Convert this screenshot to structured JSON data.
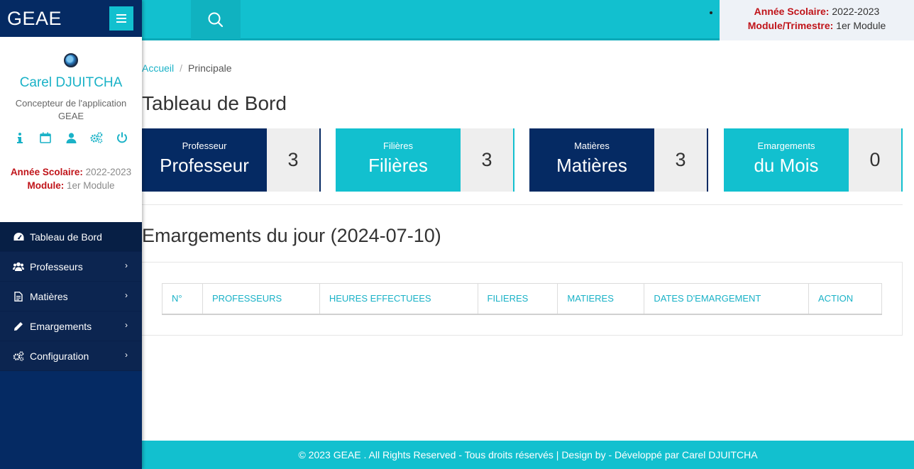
{
  "brand": {
    "name": "GEAE"
  },
  "profile": {
    "name": "Carel DJUITCHA",
    "role": "Concepteur de l'application GEAE",
    "year_label": "Année Scolaire:",
    "year_value": "2022-2023",
    "module_label": "Module:",
    "module_value": "1er Module"
  },
  "nav": [
    {
      "label": "Tableau de Bord",
      "icon": "dashboard-icon",
      "active": true
    },
    {
      "label": "Professeurs",
      "icon": "users-icon"
    },
    {
      "label": "Matières",
      "icon": "file-icon"
    },
    {
      "label": "Emargements",
      "icon": "pencil-icon"
    },
    {
      "label": "Configuration",
      "icon": "cogs-icon"
    }
  ],
  "topbar": {
    "year_label": "Année Scolaire:",
    "year_value": "2022-2023",
    "module_label": "Module/Trimestre:",
    "module_value": "1er Module"
  },
  "breadcrumb": {
    "home": "Accueil",
    "current": "Principale"
  },
  "page_title": "Tableau de Bord",
  "cards": [
    {
      "small": "Professeur",
      "big": "Professeur",
      "count": "3",
      "color": "#052a63"
    },
    {
      "small": "Filières",
      "big": "Filières",
      "count": "3",
      "color": "#12c0cf"
    },
    {
      "small": "Matières",
      "big": "Matières",
      "count": "3",
      "color": "#052a63"
    },
    {
      "small": "Emargements",
      "big": "du Mois",
      "count": "0",
      "color": "#12c0cf"
    }
  ],
  "section_title": "Emargements du jour (2024-07-10)",
  "table": {
    "headers": [
      "N°",
      "PROFESSEURS",
      "HEURES EFFECTUEES",
      "FILIERES",
      "MATIERES",
      "DATES D'EMARGEMENT",
      "ACTION"
    ]
  },
  "footer": {
    "text": "© 2023 GEAE . All Rights Reserved - Tous droits réservés | Design by - Développé par Carel DJUITCHA"
  }
}
